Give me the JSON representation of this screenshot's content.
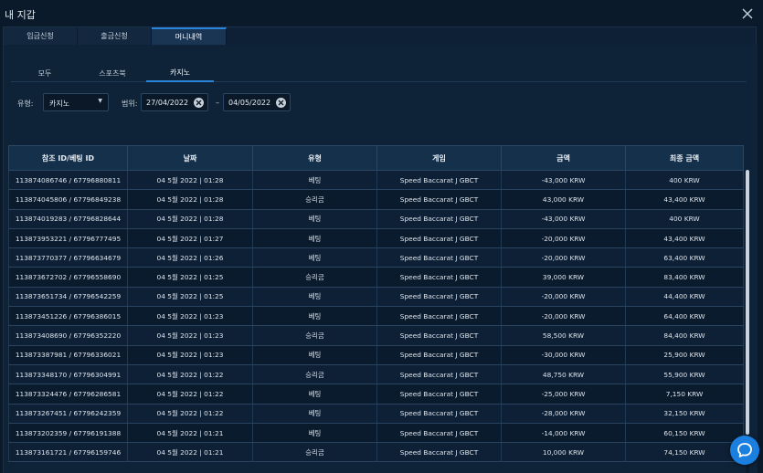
{
  "window": {
    "title": "내 지갑"
  },
  "main_tabs": [
    {
      "label": "입금신청",
      "active": false
    },
    {
      "label": "출금신청",
      "active": false
    },
    {
      "label": "머니내역",
      "active": true
    }
  ],
  "sub_tabs": [
    {
      "label": "모두",
      "active": false
    },
    {
      "label": "스포츠북",
      "active": false
    },
    {
      "label": "카지노",
      "active": true
    }
  ],
  "filters": {
    "type_label": "유형:",
    "type_value": "카지노",
    "range_label": "범위:",
    "date_from": "27/04/2022",
    "date_sep": "–",
    "date_to": "04/05/2022"
  },
  "table": {
    "headers": [
      "참조 ID/베팅 ID",
      "날짜",
      "유형",
      "게임",
      "금액",
      "최종 금액"
    ],
    "rows": [
      [
        "113874086746 / 67796880811",
        "04 5월 2022 | 01:28",
        "베팅",
        "Speed Baccarat J GBCT",
        "-43,000 KRW",
        "400 KRW"
      ],
      [
        "113874045806 / 67796849238",
        "04 5월 2022 | 01:28",
        "승리금",
        "Speed Baccarat J GBCT",
        "43,000 KRW",
        "43,400 KRW"
      ],
      [
        "113874019283 / 67796828644",
        "04 5월 2022 | 01:28",
        "베팅",
        "Speed Baccarat J GBCT",
        "-43,000 KRW",
        "400 KRW"
      ],
      [
        "113873953221 / 67796777495",
        "04 5월 2022 | 01:27",
        "베팅",
        "Speed Baccarat J GBCT",
        "-20,000 KRW",
        "43,400 KRW"
      ],
      [
        "113873770377 / 67796634679",
        "04 5월 2022 | 01:26",
        "베팅",
        "Speed Baccarat J GBCT",
        "-20,000 KRW",
        "63,400 KRW"
      ],
      [
        "113873672702 / 67796558690",
        "04 5월 2022 | 01:25",
        "승리금",
        "Speed Baccarat J GBCT",
        "39,000 KRW",
        "83,400 KRW"
      ],
      [
        "113873651734 / 67796542259",
        "04 5월 2022 | 01:25",
        "베팅",
        "Speed Baccarat J GBCT",
        "-20,000 KRW",
        "44,400 KRW"
      ],
      [
        "113873451226 / 67796386015",
        "04 5월 2022 | 01:23",
        "베팅",
        "Speed Baccarat J GBCT",
        "-20,000 KRW",
        "64,400 KRW"
      ],
      [
        "113873408690 / 67796352220",
        "04 5월 2022 | 01:23",
        "승리금",
        "Speed Baccarat J GBCT",
        "58,500 KRW",
        "84,400 KRW"
      ],
      [
        "113873387981 / 67796336021",
        "04 5월 2022 | 01:23",
        "베팅",
        "Speed Baccarat J GBCT",
        "-30,000 KRW",
        "25,900 KRW"
      ],
      [
        "113873348170 / 67796304991",
        "04 5월 2022 | 01:22",
        "승리금",
        "Speed Baccarat J GBCT",
        "48,750 KRW",
        "55,900 KRW"
      ],
      [
        "113873324476 / 67796286581",
        "04 5월 2022 | 01:22",
        "베팅",
        "Speed Baccarat J GBCT",
        "-25,000 KRW",
        "7,150 KRW"
      ],
      [
        "113873267451 / 67796242359",
        "04 5월 2022 | 01:22",
        "베팅",
        "Speed Baccarat J GBCT",
        "-28,000 KRW",
        "32,150 KRW"
      ],
      [
        "113873202359 / 67796191388",
        "04 5월 2022 | 01:21",
        "베팅",
        "Speed Baccarat J GBCT",
        "-14,000 KRW",
        "60,150 KRW"
      ],
      [
        "113873161721 / 67796159746",
        "04 5월 2022 | 01:21",
        "승리금",
        "Speed Baccarat J GBCT",
        "10,000 KRW",
        "74,150 KRW"
      ]
    ]
  },
  "icons": {
    "close": "close-icon",
    "caret": "chevron-down-icon",
    "clear": "clear-icon",
    "chat": "chat-icon"
  },
  "colors": {
    "accent": "#2a84d9",
    "chat_button": "#1b7fe0",
    "background": "#0b1a2b"
  }
}
